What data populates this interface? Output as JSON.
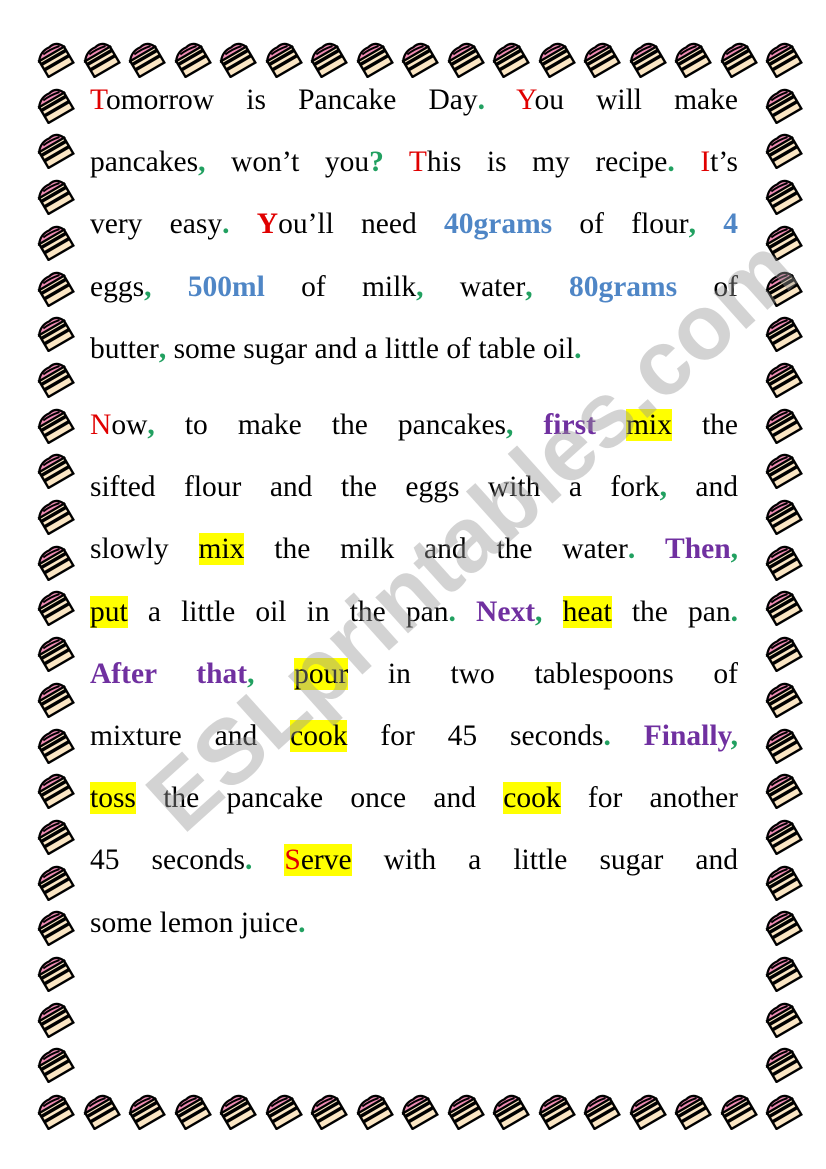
{
  "document": {
    "border_icon": "cake-slice-icon",
    "watermark": "ESLprintables.com",
    "colors": {
      "capital": "#e00000",
      "punctuation": "#21a060",
      "quantity": "#4f86c6",
      "sequence_word": "#7030a0",
      "verb_highlight": "#ffff00"
    },
    "paragraphs": [
      {
        "lines": [
          [
            [
              "T",
              "r"
            ],
            [
              "omorrow is Pancake Day",
              "n"
            ],
            [
              ".",
              "g"
            ],
            [
              " ",
              "n"
            ],
            [
              "Y",
              "r"
            ],
            [
              "ou will make",
              "n"
            ]
          ],
          [
            [
              "pancakes",
              "n"
            ],
            [
              ",",
              "g"
            ],
            [
              " won’t you",
              "n"
            ],
            [
              "?",
              "g"
            ],
            [
              " ",
              "n"
            ],
            [
              "T",
              "r"
            ],
            [
              "his is my recipe",
              "n"
            ],
            [
              ".",
              "g"
            ],
            [
              " ",
              "n"
            ],
            [
              "I",
              "r"
            ],
            [
              "t’s",
              "n"
            ]
          ],
          [
            [
              "very easy",
              "n"
            ],
            [
              ".",
              "g"
            ],
            [
              " ",
              "n"
            ],
            [
              "Y",
              "rb"
            ],
            [
              "ou’ll need ",
              "n"
            ],
            [
              "40grams",
              "b"
            ],
            [
              " of flour",
              "n"
            ],
            [
              ",",
              "g"
            ],
            [
              " ",
              "n"
            ],
            [
              "4",
              "b"
            ]
          ],
          [
            [
              "eggs",
              "n"
            ],
            [
              ",",
              "g"
            ],
            [
              " ",
              "n"
            ],
            [
              "500ml",
              "b"
            ],
            [
              " of milk",
              "n"
            ],
            [
              ",",
              "g"
            ],
            [
              " water",
              "n"
            ],
            [
              ",",
              "g"
            ],
            [
              " ",
              "n"
            ],
            [
              "80grams",
              "b"
            ],
            [
              " of",
              "n"
            ]
          ],
          [
            [
              "butter",
              "n"
            ],
            [
              ",",
              "g"
            ],
            [
              " some sugar and a little of table oil",
              "n"
            ],
            [
              ".",
              "g"
            ]
          ]
        ]
      },
      {
        "lines": [
          [
            [
              "N",
              "r"
            ],
            [
              "ow",
              "n"
            ],
            [
              ",",
              "g"
            ],
            [
              " to make the pancakes",
              "n"
            ],
            [
              ",",
              "g"
            ],
            [
              " ",
              "n"
            ],
            [
              "first",
              "p"
            ],
            [
              " ",
              "n"
            ],
            [
              "mix",
              "h"
            ],
            [
              " the",
              "n"
            ]
          ],
          [
            [
              "sifted flour and the eggs with a fork",
              "n"
            ],
            [
              ",",
              "g"
            ],
            [
              " and",
              "n"
            ]
          ],
          [
            [
              "slowly ",
              "n"
            ],
            [
              "mix",
              "h"
            ],
            [
              " the milk and the water",
              "n"
            ],
            [
              ".",
              "g"
            ],
            [
              " ",
              "n"
            ],
            [
              "Then",
              "p"
            ],
            [
              ",",
              "g"
            ]
          ],
          [
            [
              "put",
              "h"
            ],
            [
              " a little oil in the pan",
              "n"
            ],
            [
              ".",
              "g"
            ],
            [
              " ",
              "n"
            ],
            [
              "Next",
              "p"
            ],
            [
              ",",
              "g"
            ],
            [
              " ",
              "n"
            ],
            [
              "heat",
              "h"
            ],
            [
              " the pan",
              "n"
            ],
            [
              ".",
              "g"
            ]
          ],
          [
            [
              "After that",
              "p"
            ],
            [
              ",",
              "g"
            ],
            [
              " ",
              "n"
            ],
            [
              "pour",
              "h"
            ],
            [
              " in two tablespoons of",
              "n"
            ]
          ],
          [
            [
              "mixture and ",
              "n"
            ],
            [
              "cook",
              "h"
            ],
            [
              " for 45 seconds",
              "n"
            ],
            [
              ".",
              "g"
            ],
            [
              " ",
              "n"
            ],
            [
              "Finally",
              "p"
            ],
            [
              ",",
              "g"
            ]
          ],
          [
            [
              "toss",
              "h"
            ],
            [
              " the pancake once and ",
              "n"
            ],
            [
              "cook",
              "h"
            ],
            [
              " for another",
              "n"
            ]
          ],
          [
            [
              "45 seconds",
              "n"
            ],
            [
              ".",
              "g"
            ],
            [
              " ",
              "n"
            ],
            [
              "S",
              "r h"
            ],
            [
              "erve",
              "h"
            ],
            [
              " with a little sugar and",
              "n"
            ]
          ],
          [
            [
              "some lemon juice",
              "n"
            ],
            [
              ".",
              "g"
            ]
          ]
        ]
      }
    ]
  }
}
